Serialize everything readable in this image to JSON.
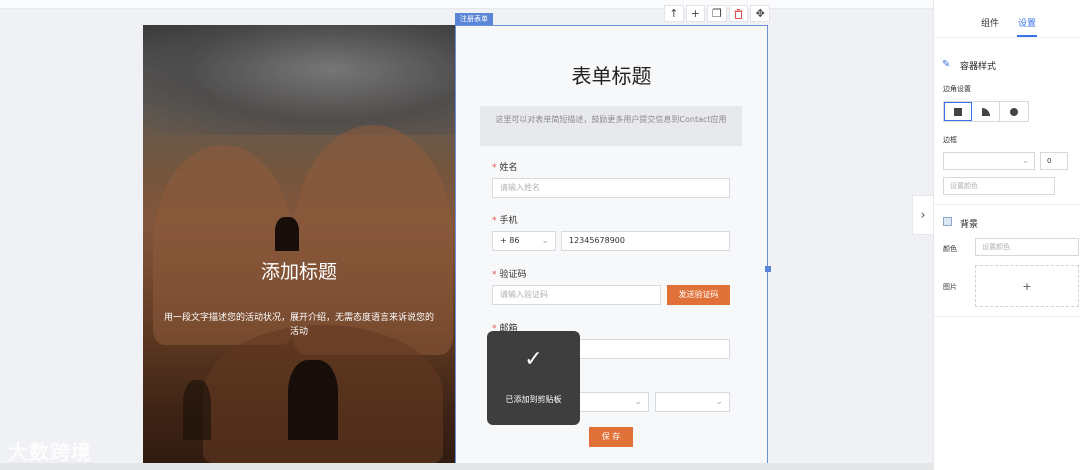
{
  "canvas": {
    "selection_tag": "注册表单",
    "toolbar": [
      {
        "name": "move-up-icon",
        "glyph": "↑"
      },
      {
        "name": "add-icon",
        "glyph": "+"
      },
      {
        "name": "copy-icon",
        "glyph": "❐"
      },
      {
        "name": "delete-icon",
        "glyph": "🗑"
      },
      {
        "name": "drag-move-icon",
        "glyph": "✥"
      }
    ]
  },
  "hero": {
    "title": "添加标题",
    "description": "用一段文字描述您的活动状况，展开介绍，无需态度语言来诉说您的活动"
  },
  "form": {
    "title": "表单标题",
    "description": "这里可以对表单简短描述，鼓励更多用户提交信息到Contact应用",
    "name": {
      "label": "姓名",
      "placeholder": "请输入姓名"
    },
    "phone": {
      "label": "手机",
      "country_code": "+ 86",
      "value": "12345678900"
    },
    "code": {
      "label": "验证码",
      "placeholder": "请输入验证码",
      "button": "发送验证码"
    },
    "email": {
      "label": "邮箱"
    },
    "save_button": "保 存",
    "required_mark": "*"
  },
  "toast": {
    "message": "已添加到剪贴板"
  },
  "sidebar": {
    "tabs": [
      "组件",
      "设置"
    ],
    "active_tab": "设置",
    "container_style_title": "容器样式",
    "corner_label": "边角设置",
    "border_label": "边框",
    "border_width": "0",
    "border_color_placeholder": "设置颜色",
    "background_title": "背景",
    "color_label": "颜色",
    "color_placeholder": "设置颜色",
    "image_label": "图片",
    "upload_glyph": "+"
  },
  "watermark": "大数跨境",
  "colors": {
    "accent": "#3b73e6",
    "orange": "#e07139",
    "selection": "#5b86d8"
  }
}
